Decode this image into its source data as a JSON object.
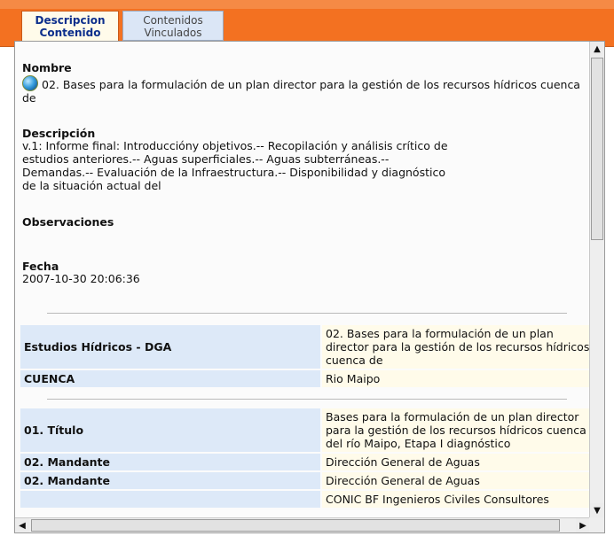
{
  "tabs": [
    {
      "line1": "Descripcion",
      "line2": "Contenido"
    },
    {
      "line1": "Contenidos",
      "line2": "Vinculados"
    }
  ],
  "nombre": {
    "label": "Nombre",
    "value": "02. Bases para la formulación de un plan director para la gestión de los recursos hídricos cuenca de"
  },
  "descripcion": {
    "label": "Descripción",
    "lines": [
      "v.1: Informe final: Introduccióny objetivos.-- Recopilación y análisis crítico de",
      "estudios anteriores.-- Aguas superficiales.-- Aguas subterráneas.--",
      "Demandas.-- Evaluación de la Infraestructura.-- Disponibilidad y diagnóstico",
      "de la situación actual del"
    ]
  },
  "observaciones": {
    "label": "Observaciones"
  },
  "fecha": {
    "label": "Fecha",
    "value": "2007-10-30 20:06:36"
  },
  "table1": {
    "rows": [
      {
        "key": "Estudios Hídricos - DGA",
        "value": "02. Bases para la formulación de un plan director para la gestión de los recursos hídricos cuenca de"
      },
      {
        "key": "CUENCA",
        "value": "Rio Maipo"
      }
    ]
  },
  "table2": {
    "rows": [
      {
        "key": "01. Título",
        "value": "Bases para la formulación de un plan director para la gestión de los recursos hídricos cuenca del río Maipo, Etapa I diagnóstico"
      },
      {
        "key": "02. Mandante",
        "value": "Dirección General de Aguas"
      },
      {
        "key": "02. Mandante",
        "value": "Dirección General de Aguas"
      },
      {
        "key": "",
        "value": "CONIC BF Ingenieros Civiles Consultores"
      }
    ]
  },
  "icons": {
    "nombre": "globe-icon",
    "scroll_up": "arrow-up-icon",
    "scroll_down": "arrow-down-icon",
    "scroll_left": "arrow-left-icon",
    "scroll_right": "arrow-right-icon"
  },
  "colors": {
    "header": "#f37121",
    "key_cell": "#dde9f8",
    "value_cell": "#fffbea",
    "active_tab_text": "#0b2e8c"
  }
}
